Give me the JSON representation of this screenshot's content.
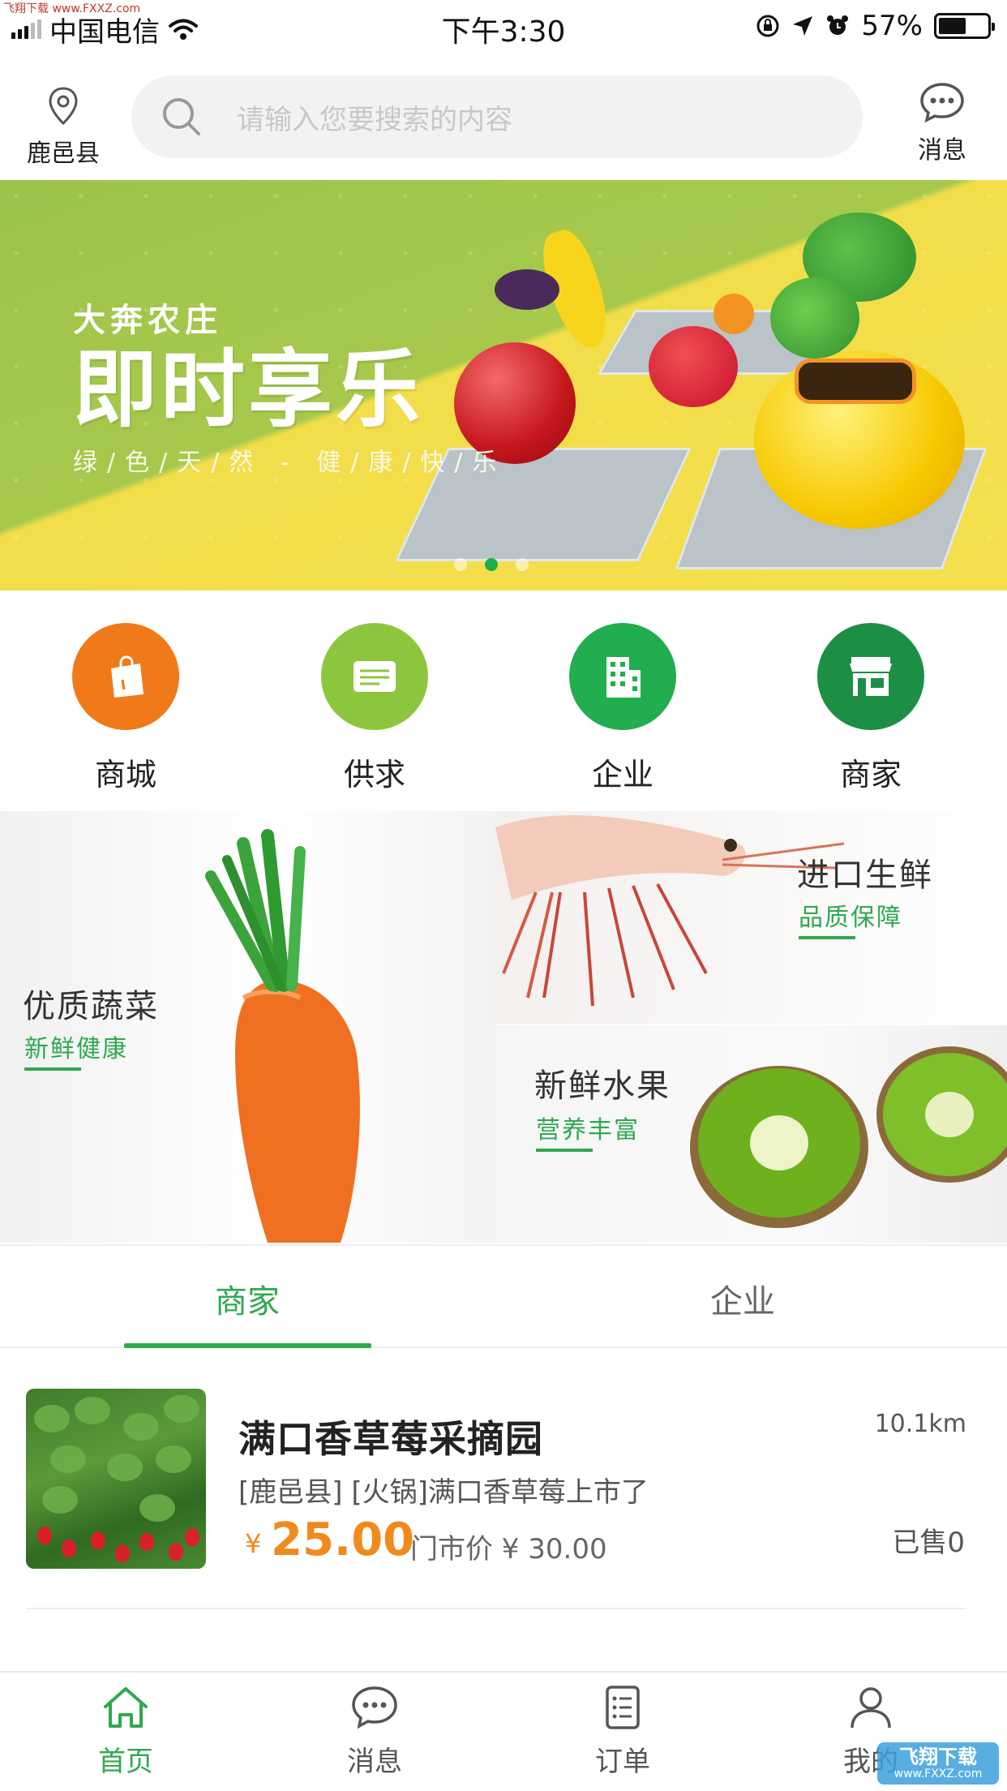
{
  "status_bar": {
    "carrier": "中国电信",
    "time": "下午3:30",
    "battery_pct": "57%",
    "battery_level": 0.57,
    "watermark": "飞翔下载 www.FXXZ.com"
  },
  "header": {
    "location": "鹿邑县",
    "search_placeholder": "请输入您要搜索的内容",
    "messages_label": "消息"
  },
  "banner": {
    "brand": "大奔农庄",
    "headline": "即时享乐",
    "tagline": "绿/色/天/然 - 健/康/快/乐",
    "dots": 3,
    "active_dot": 1
  },
  "categories": [
    {
      "label": "商城",
      "icon": "shopping-bag-icon",
      "color": "#f07a1a"
    },
    {
      "label": "供求",
      "icon": "card-icon",
      "color": "#8cc63f"
    },
    {
      "label": "企业",
      "icon": "building-icon",
      "color": "#22ad4e"
    },
    {
      "label": "商家",
      "icon": "storefront-icon",
      "color": "#1d8f45"
    }
  ],
  "promos": {
    "vegetables": {
      "title": "优质蔬菜",
      "subtitle": "新鲜健康"
    },
    "seafood": {
      "title": "进口生鲜",
      "subtitle": "品质保障"
    },
    "fruit": {
      "title": "新鲜水果",
      "subtitle": "营养丰富"
    }
  },
  "tabs": {
    "merchants": "商家",
    "enterprises": "企业",
    "active": "merchants"
  },
  "listing": {
    "name": "满口香草莓采摘园",
    "description": "[鹿邑县] [火锅]满口香草莓上市了",
    "currency": "¥",
    "price": "25.00",
    "original_price": "门市价 ¥ 30.00",
    "distance": "10.1km",
    "sold": "已售0"
  },
  "bottom_nav": [
    {
      "label": "首页",
      "icon": "home-icon",
      "active": true
    },
    {
      "label": "消息",
      "icon": "chat-icon",
      "active": false
    },
    {
      "label": "订单",
      "icon": "order-list-icon",
      "active": false
    },
    {
      "label": "我的",
      "icon": "user-icon",
      "active": false
    }
  ],
  "watermark_br": {
    "text": "飞翔下载",
    "url": "www.FXXZ.com"
  },
  "colors": {
    "accent": "#2fa84f",
    "price": "#f08a1c"
  }
}
